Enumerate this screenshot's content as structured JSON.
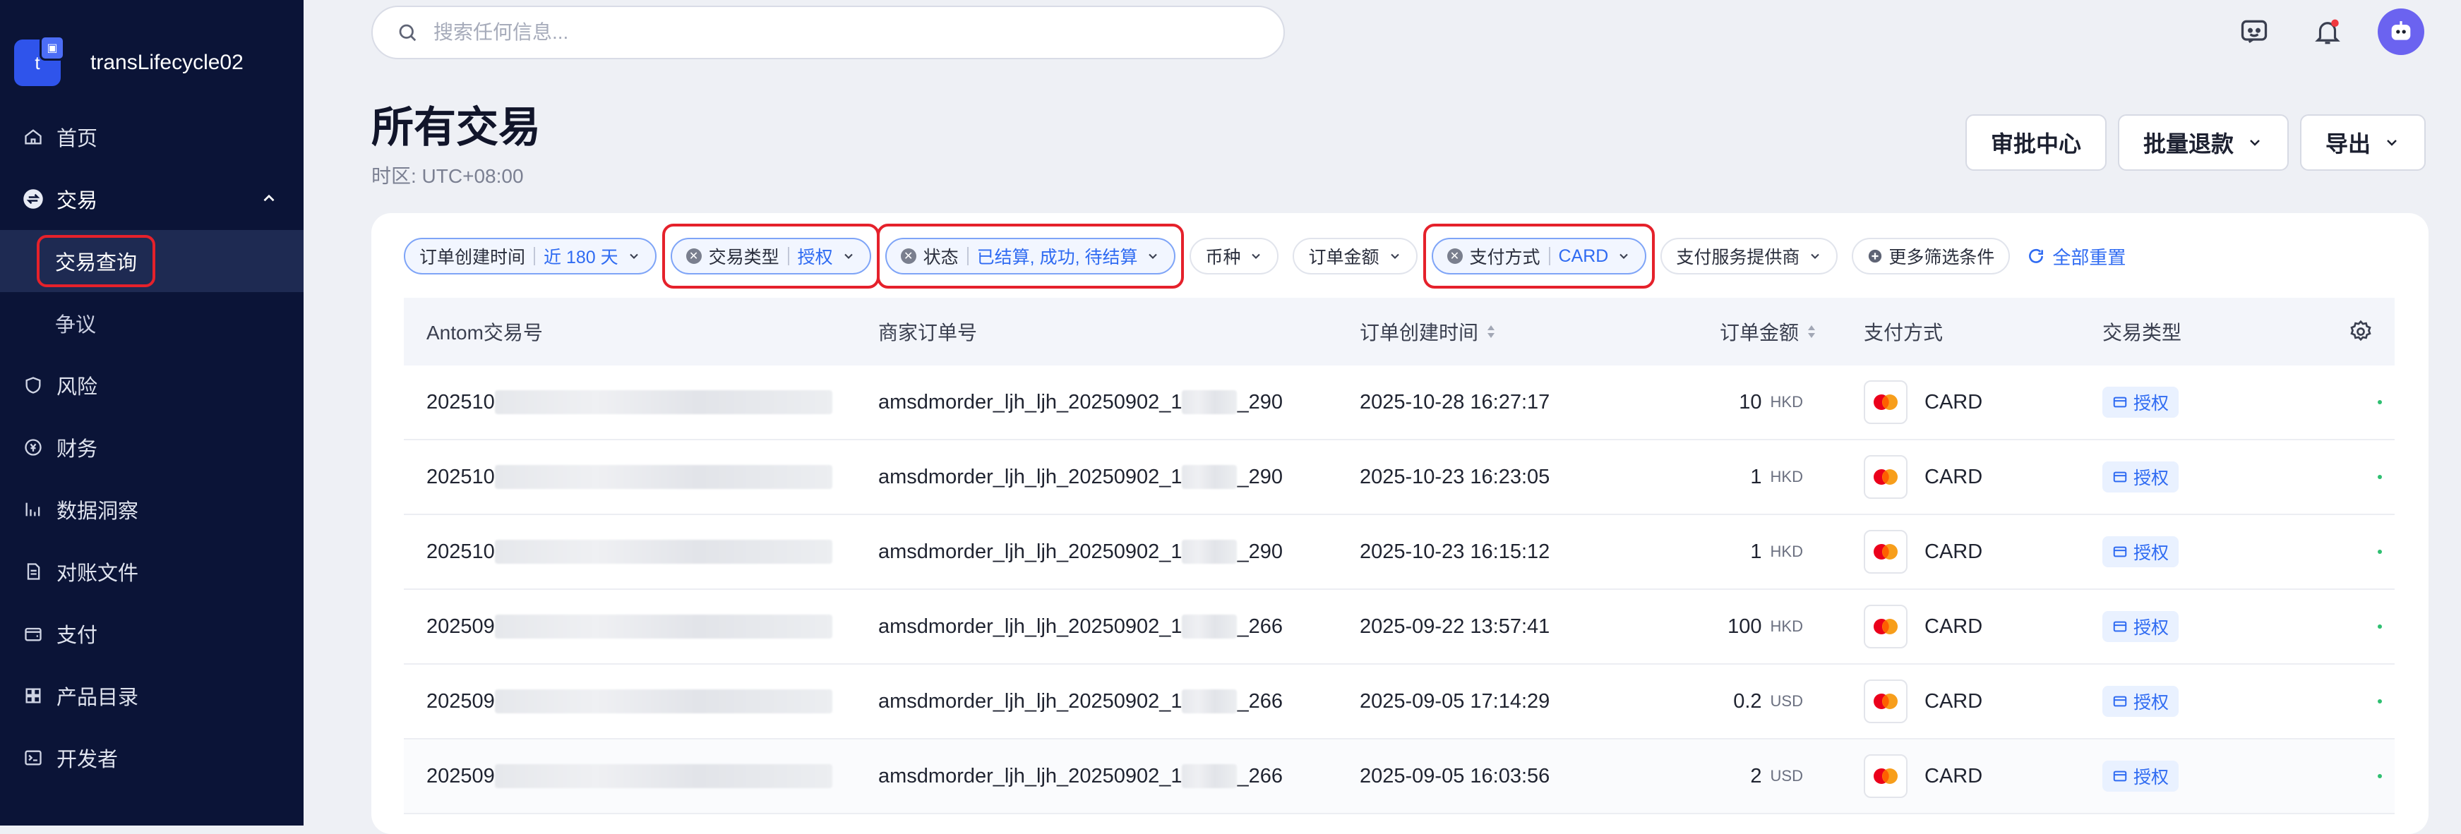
{
  "sidebar": {
    "brand": {
      "logo_letter": "t",
      "name": "transLifecycle02"
    },
    "items": [
      {
        "label": "首页",
        "icon": "home-icon"
      },
      {
        "label": "交易",
        "icon": "transaction-icon"
      },
      {
        "label": "交易查询",
        "icon": ""
      },
      {
        "label": "争议",
        "icon": ""
      },
      {
        "label": "风险",
        "icon": "shield-icon"
      },
      {
        "label": "财务",
        "icon": "finance-icon"
      },
      {
        "label": "数据洞察",
        "icon": "chart-icon"
      },
      {
        "label": "对账文件",
        "icon": "file-icon"
      },
      {
        "label": "支付",
        "icon": "wallet-icon"
      },
      {
        "label": "产品目录",
        "icon": "catalog-icon"
      },
      {
        "label": "开发者",
        "icon": "terminal-icon"
      }
    ]
  },
  "search": {
    "placeholder": "搜索任何信息..."
  },
  "page": {
    "title": "所有交易",
    "timezone": "时区: UTC+08:00"
  },
  "actions": {
    "approval": "审批中心",
    "bulk_refund": "批量退款",
    "export": "导出"
  },
  "filters": {
    "created_time": {
      "label": "订单创建时间",
      "value": "近 180 天"
    },
    "tx_type": {
      "label": "交易类型",
      "value": "授权"
    },
    "status": {
      "label": "状态",
      "value": "已结算, 成功, 待结算"
    },
    "currency": {
      "label": "币种"
    },
    "amount": {
      "label": "订单金额"
    },
    "payment_method": {
      "label": "支付方式",
      "value": "CARD"
    },
    "provider": {
      "label": "支付服务提供商"
    },
    "more": {
      "label": "更多筛选条件"
    },
    "reset": {
      "label": "全部重置"
    }
  },
  "table": {
    "columns": [
      "Antom交易号",
      "商家订单号",
      "订单创建时间",
      "订单金额",
      "支付方式",
      "交易类型"
    ],
    "rows": [
      {
        "tx_prefix": "202510",
        "order_prefix": "amsdmorder_ljh_ljh_20250902_1",
        "order_suffix": "_290",
        "created": "2025-10-28 16:27:17",
        "amount": "10",
        "currency": "HKD",
        "method": "CARD",
        "type": "授权"
      },
      {
        "tx_prefix": "202510",
        "order_prefix": "amsdmorder_ljh_ljh_20250902_1",
        "order_suffix": "_290",
        "created": "2025-10-23 16:23:05",
        "amount": "1",
        "currency": "HKD",
        "method": "CARD",
        "type": "授权"
      },
      {
        "tx_prefix": "202510",
        "order_prefix": "amsdmorder_ljh_ljh_20250902_1",
        "order_suffix": "_290",
        "created": "2025-10-23 16:15:12",
        "amount": "1",
        "currency": "HKD",
        "method": "CARD",
        "type": "授权"
      },
      {
        "tx_prefix": "202509",
        "order_prefix": "amsdmorder_ljh_ljh_20250902_1",
        "order_suffix": "_266",
        "created": "2025-09-22 13:57:41",
        "amount": "100",
        "currency": "HKD",
        "method": "CARD",
        "type": "授权"
      },
      {
        "tx_prefix": "202509",
        "order_prefix": "amsdmorder_ljh_ljh_20250902_1",
        "order_suffix": "_266",
        "created": "2025-09-05 17:14:29",
        "amount": "0.2",
        "currency": "USD",
        "method": "CARD",
        "type": "授权"
      },
      {
        "tx_prefix": "202509",
        "order_prefix": "amsdmorder_ljh_ljh_20250902_1",
        "order_suffix": "_266",
        "created": "2025-09-05 16:03:56",
        "amount": "2",
        "currency": "USD",
        "method": "CARD",
        "type": "授权"
      }
    ]
  },
  "colors": {
    "sidebar": "#0b1437",
    "accent": "#2f6bf2",
    "highlight": "#e5212b"
  }
}
